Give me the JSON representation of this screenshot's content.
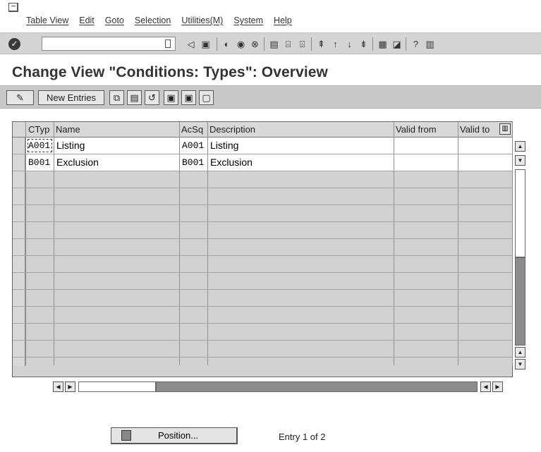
{
  "menu": {
    "items": [
      "Table View",
      "Edit",
      "Goto",
      "Selection",
      "Utilities(M)",
      "System",
      "Help"
    ]
  },
  "toolbar": {
    "command_field_value": "",
    "icons": [
      "enter-icon",
      "back-icon",
      "save-icon",
      "exit-icon",
      "cancel-icon",
      "stop-icon",
      "print-icon",
      "find-icon",
      "find-next-icon",
      "first-page-icon",
      "prev-page-icon",
      "next-page-icon",
      "last-page-icon",
      "new-session-icon",
      "shortcut-icon",
      "help-icon",
      "layout-icon"
    ]
  },
  "page": {
    "title": "Change View \"Conditions: Types\": Overview"
  },
  "app_toolbar": {
    "new_entries_label": "New Entries"
  },
  "table": {
    "headers": [
      "CTyp",
      "Name",
      "AcSq",
      "Description",
      "Valid from",
      "Valid to"
    ],
    "rows": [
      [
        "A001",
        "Listing",
        "A001",
        "Listing",
        "",
        ""
      ],
      [
        "B001",
        "Exclusion",
        "B001",
        "Exclusion",
        "",
        ""
      ]
    ],
    "empty_row_count": 12
  },
  "footer": {
    "position_button_label": "Position...",
    "entry_text": "Entry 1 of 2"
  }
}
